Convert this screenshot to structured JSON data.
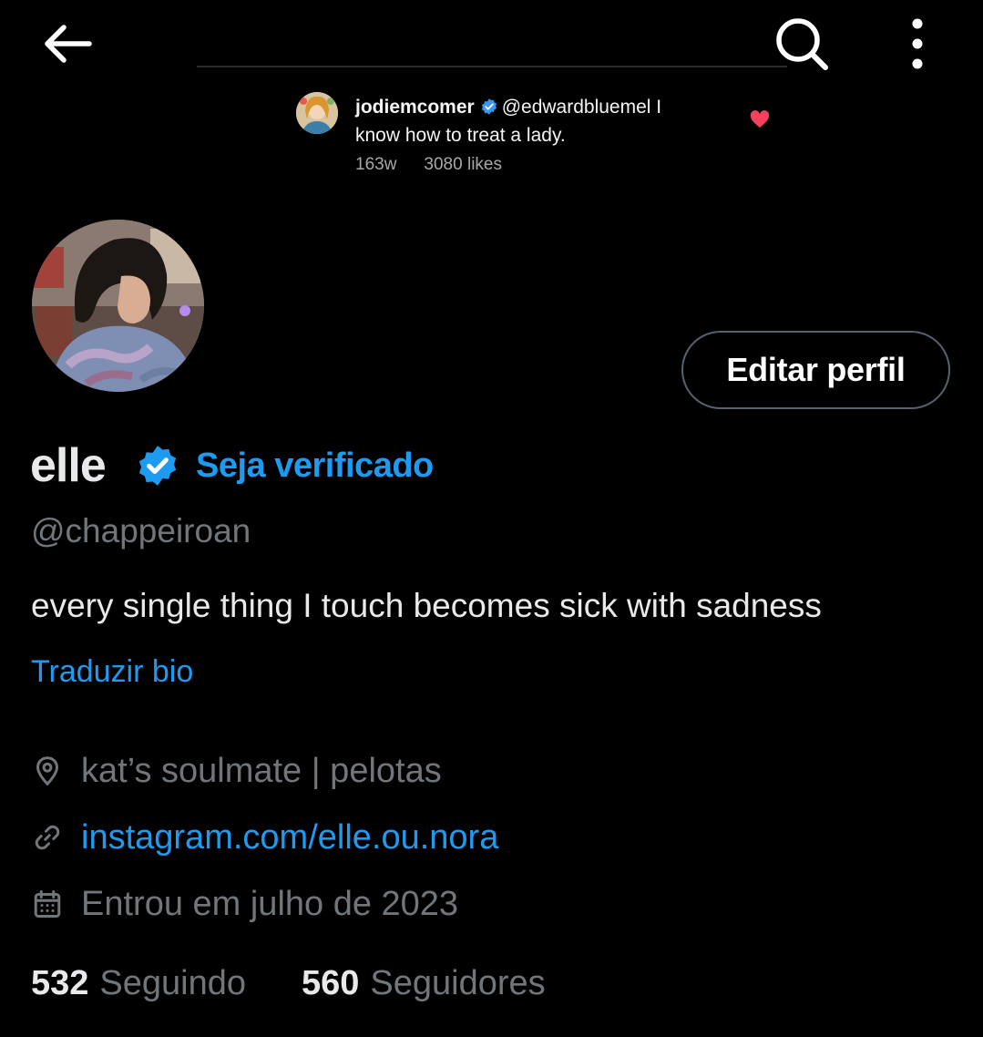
{
  "topbar": {
    "back_icon": "arrow-left-icon",
    "search_icon": "search-icon",
    "more_icon": "more-vertical-icon"
  },
  "banner_comment": {
    "username": "jodiemcomer",
    "mention": "@edwardbluemel",
    "text_line1_suffix": " I",
    "text_line2": "know how to treat a lady.",
    "age": "163w",
    "likes": "3080 likes",
    "verified_icon": "verified-badge-icon",
    "heart_icon": "heart-icon"
  },
  "profile": {
    "display_name": "elle",
    "verified_icon": "verified-badge-icon",
    "get_verified": "Seja verificado",
    "handle": "@chappeiroan",
    "bio": "every single thing I touch becomes sick with sadness",
    "translate_bio": "Traduzir bio",
    "edit_button": "Editar perfil"
  },
  "info": {
    "location_icon": "location-pin-icon",
    "location": "kat’s soulmate | pelotas",
    "link_icon": "link-icon",
    "link": "instagram.com/elle.ou.nora",
    "joined_icon": "calendar-icon",
    "joined": "Entrou em julho de 2023"
  },
  "stats": {
    "following_count": "532",
    "following_label": "Seguindo",
    "followers_count": "560",
    "followers_label": "Seguidores"
  },
  "colors": {
    "background": "#000000",
    "accent": "#1d9bf0",
    "secondary_text": "#71767b",
    "primary_text": "#e7e9ea",
    "heart": "#f5405e"
  }
}
